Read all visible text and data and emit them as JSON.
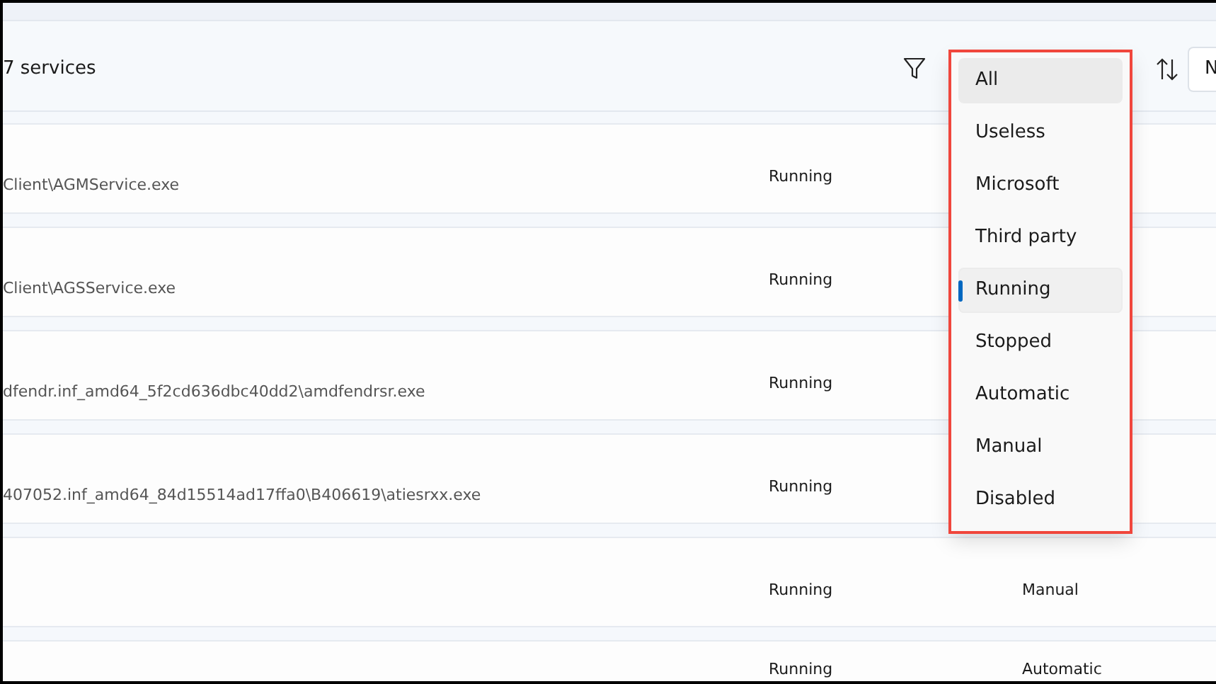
{
  "header": {
    "count": "7 services",
    "sort_button": "N"
  },
  "rows": [
    {
      "path": "Client\\AGMService.exe",
      "status": "Running"
    },
    {
      "path": "Client\\AGSService.exe",
      "status": "Running"
    },
    {
      "path": "dfendr.inf_amd64_5f2cd636dbc40dd2\\amdfendrsr.exe",
      "status": "Running"
    },
    {
      "path": "407052.inf_amd64_84d15514ad17ffa0\\B406619\\atiesrxx.exe",
      "status": "Running"
    },
    {
      "status": "Running",
      "startup": "Manual"
    },
    {
      "status": "Running",
      "startup": "Automatic"
    }
  ],
  "filter_menu": {
    "highlighted": true,
    "items": [
      {
        "label": "All",
        "selected": false,
        "hovered": true
      },
      {
        "label": "Useless",
        "selected": false,
        "hovered": false
      },
      {
        "label": "Microsoft",
        "selected": false,
        "hovered": false
      },
      {
        "label": "Third party",
        "selected": false,
        "hovered": false
      },
      {
        "label": "Running",
        "selected": true,
        "hovered": false
      },
      {
        "label": "Stopped",
        "selected": false,
        "hovered": false
      },
      {
        "label": "Automatic",
        "selected": false,
        "hovered": false
      },
      {
        "label": "Manual",
        "selected": false,
        "hovered": false
      },
      {
        "label": "Disabled",
        "selected": false,
        "hovered": false
      }
    ]
  }
}
